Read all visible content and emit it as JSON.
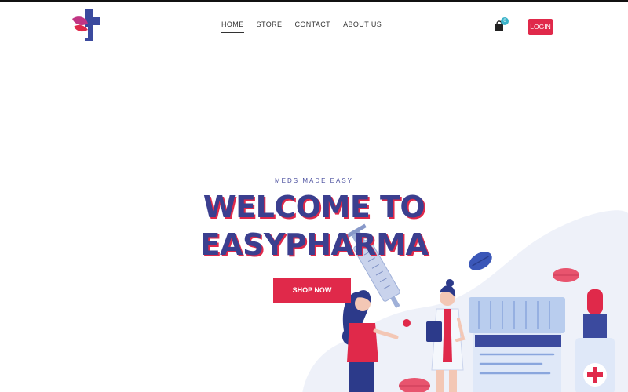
{
  "nav": {
    "items": [
      {
        "label": "HOME",
        "active": true
      },
      {
        "label": "STORE",
        "active": false
      },
      {
        "label": "CONTACT",
        "active": false
      },
      {
        "label": "ABOUT US",
        "active": false
      }
    ],
    "cart_count": "0",
    "cart_icon": "shopping-bag-icon",
    "login_label": "LOGIN"
  },
  "logo": {
    "icon": "medical-cross-leaf-logo"
  },
  "hero": {
    "tagline": "MEDS MADE EASY",
    "title_line1": "WELCOME TO",
    "title_line2": "EASYPHARMA",
    "cta_label": "SHOP NOW"
  },
  "colors": {
    "brand_navy": "#3b3f8f",
    "brand_red": "#e0294a",
    "badge_teal": "#3bb3c9"
  }
}
